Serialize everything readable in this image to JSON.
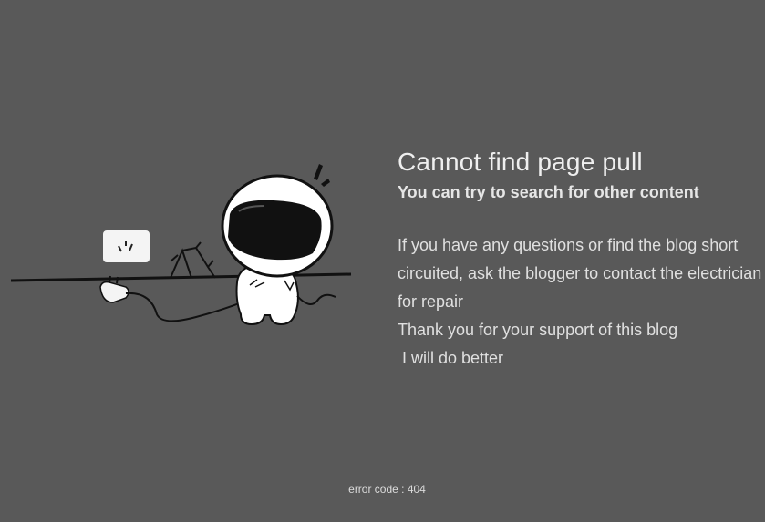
{
  "message": {
    "title": "Cannot find page pull",
    "subtitle": "You can try to search for other content",
    "paragraphs": [
      "If you have any questions or find the blog short circuited, ask the blogger to contact the electrician for repair",
      "Thank you for your support of this blog",
      " I will do better"
    ]
  },
  "footer": {
    "error_code": "error code : 404"
  },
  "colors": {
    "background": "#595959",
    "text": "#e9e9e9"
  },
  "icons": {
    "illustration": "unplugged-astronaut-illustration"
  }
}
